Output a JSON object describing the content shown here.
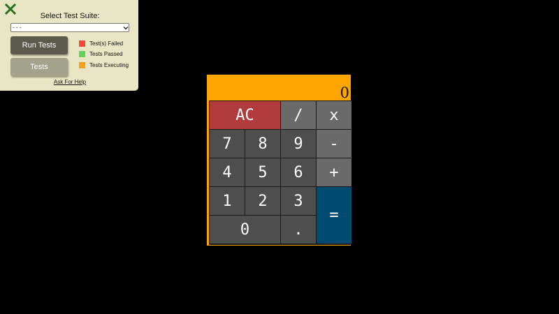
{
  "test_panel": {
    "title": "Select Test Suite:",
    "suite_select_value": "- - -",
    "run_button_label": "Run Tests",
    "tests_button_label": "Tests",
    "legend": [
      {
        "label": "Test(s) Failed",
        "color": "#f24a3a"
      },
      {
        "label": "Tests Passed",
        "color": "#63d45a"
      },
      {
        "label": "Tests Executing",
        "color": "#f9a11b"
      }
    ],
    "help_link": "Ask For Help",
    "close_icon": "close-icon",
    "accent_color": "#2a6e1f"
  },
  "calculator": {
    "display": "0",
    "keys": {
      "clear": "AC",
      "divide": "/",
      "multiply": "x",
      "seven": "7",
      "eight": "8",
      "nine": "9",
      "subtract": "-",
      "four": "4",
      "five": "5",
      "six": "6",
      "add": "+",
      "one": "1",
      "two": "2",
      "three": "3",
      "equals": "=",
      "zero": "0",
      "decimal": "."
    },
    "colors": {
      "frame": "#ffa500",
      "clear": "#b13a3c",
      "equals": "#004c71",
      "operator": "#6a6a6a",
      "digit": "#4e4e4e"
    }
  }
}
